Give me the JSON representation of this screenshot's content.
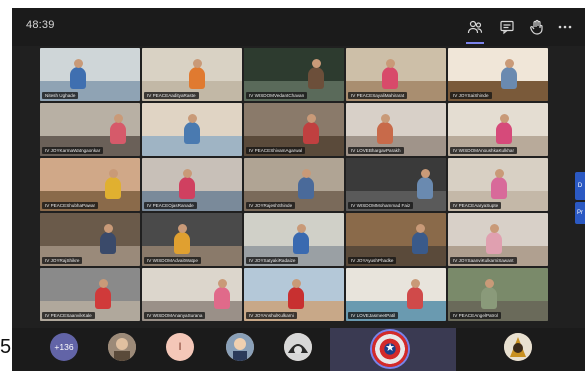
{
  "window": {
    "timer": "48:39"
  },
  "toolbar": {
    "icons": [
      "participants-icon",
      "chat-icon",
      "raise-hand-icon",
      "more-options-icon"
    ]
  },
  "side_tab": {
    "label_top": "D",
    "label_bottom": "Pr"
  },
  "participants": [
    {
      "name": "Nitesh Ughade",
      "pinned": false
    },
    {
      "name": "IV PEACEAadityaRaste",
      "pinned": false
    },
    {
      "name": "IV WISDOMVedantChavan",
      "pinned": false
    },
    {
      "name": "IV PEACESayaliMahirarat",
      "pinned": false
    },
    {
      "name": "IV JOYSaiShinde",
      "pinned": false
    },
    {
      "name": "IV JOYKarmaWatngaonkar",
      "pinned": false
    },
    {
      "name": "",
      "pinned": false
    },
    {
      "name": "IV PEACEShivamAgarwal",
      "pinned": false
    },
    {
      "name": "IV LOVEBhargavParakh",
      "pinned": false
    },
    {
      "name": "IV WISDOMAnoushkaKulkhar",
      "pinned": false
    },
    {
      "name": "IV PEACEShubhaPawar",
      "pinned": false
    },
    {
      "name": "IV PEACEOjasRanade",
      "pinned": false
    },
    {
      "name": "IV JOYRajeshShinde",
      "pinned": false
    },
    {
      "name": "IV WISDOMMohammad Faiz",
      "pinned": false
    },
    {
      "name": "IV PEACEAaryaSupte",
      "pinned": false
    },
    {
      "name": "IV JOYRajShikre",
      "pinned": false
    },
    {
      "name": "IV WISDOMAdvaitWatpe",
      "pinned": false
    },
    {
      "name": "IV JOYSatyakiRadaize",
      "pinned": false
    },
    {
      "name": "IV JOYAyushPhadke",
      "pinned": false
    },
    {
      "name": "IV JOYSaanviKulkarniSawant",
      "pinned": false
    },
    {
      "name": "IV PEACESaanvikKale",
      "pinned": false
    },
    {
      "name": "IV WISDOMAnanyaSurana",
      "pinned": false
    },
    {
      "name": "IV JOYAnshulKulkarni",
      "pinned": false
    },
    {
      "name": "IV LOVEJasmeetPatil",
      "pinned": false
    },
    {
      "name": "IV PEACEAngelPatrol",
      "pinned": false
    }
  ],
  "bottom": {
    "overflow_count": "+136",
    "initial": "I",
    "cut_digit": "5"
  },
  "colors": {
    "accent": "#7b83eb",
    "overflow": "#6264a7",
    "side_tab": "#2b59c3"
  }
}
